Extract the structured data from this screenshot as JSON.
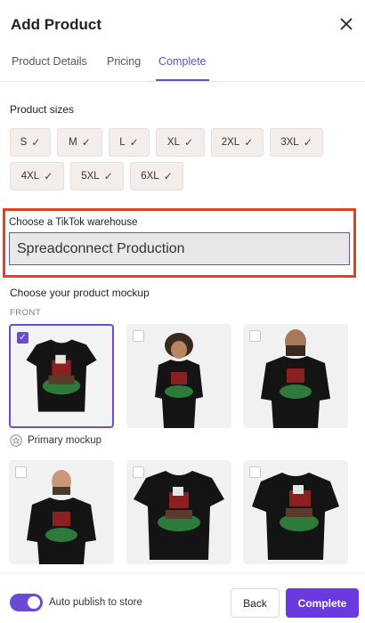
{
  "header": {
    "title": "Add Product",
    "close_icon": "close-icon"
  },
  "tabs": [
    {
      "label": "Product Details",
      "active": false
    },
    {
      "label": "Pricing",
      "active": false
    },
    {
      "label": "Complete",
      "active": true
    }
  ],
  "sizes": {
    "label": "Product sizes",
    "items": [
      {
        "label": "S",
        "checked": true
      },
      {
        "label": "M",
        "checked": true
      },
      {
        "label": "L",
        "checked": true
      },
      {
        "label": "XL",
        "checked": true
      },
      {
        "label": "2XL",
        "checked": true
      },
      {
        "label": "3XL",
        "checked": true
      },
      {
        "label": "4XL",
        "checked": true
      },
      {
        "label": "5XL",
        "checked": true
      },
      {
        "label": "6XL",
        "checked": true
      }
    ]
  },
  "warehouse": {
    "label": "Choose a TikTok warehouse",
    "value": "Spreadconnect Production"
  },
  "mockup": {
    "label": "Choose your product mockup",
    "front_label": "FRONT",
    "primary_label": "Primary mockup",
    "cards": [
      {
        "name": "mockup-flat-tee",
        "selected": true
      },
      {
        "name": "mockup-model-curly",
        "selected": false
      },
      {
        "name": "mockup-model-beard",
        "selected": false
      },
      {
        "name": "mockup-model-man",
        "selected": false
      },
      {
        "name": "mockup-flat-tee-angle",
        "selected": false
      },
      {
        "name": "mockup-flat-tee-hanging",
        "selected": false
      }
    ]
  },
  "footer": {
    "auto_publish_label": "Auto publish to store",
    "auto_publish_on": true,
    "back_label": "Back",
    "complete_label": "Complete"
  },
  "colors": {
    "accent": "#6a4bd8",
    "highlight": "#e2401f"
  }
}
